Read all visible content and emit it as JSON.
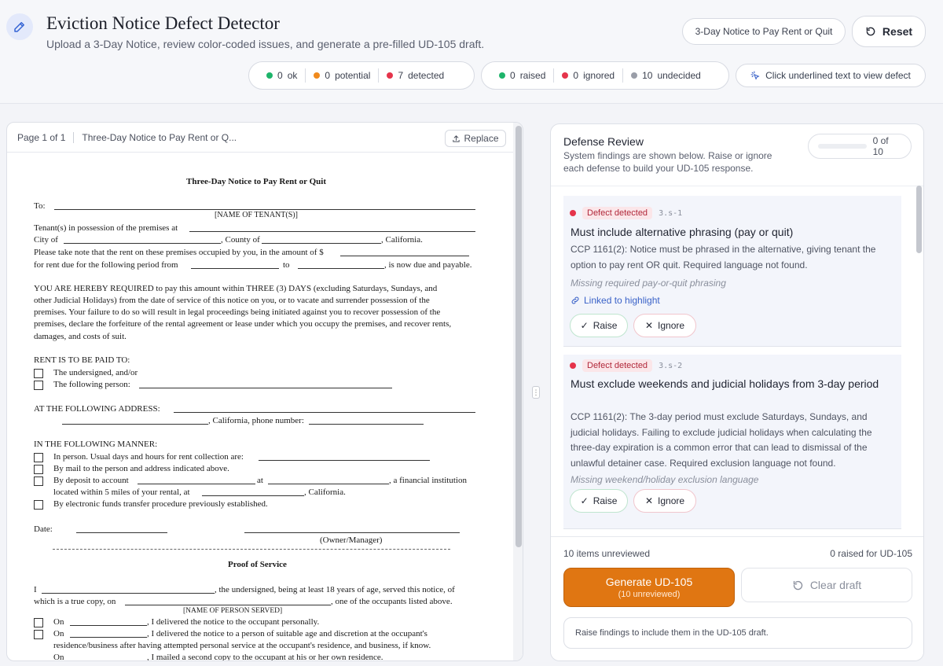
{
  "header": {
    "title": "Eviction Notice Defect Detector",
    "subtitle": "Upload a 3-Day Notice, review color-coded issues, and generate a pre-filled UD-105 draft.",
    "notice_type": "3-Day Notice to Pay Rent or Quit",
    "reset_label": "Reset",
    "hint": "Click underlined text to view defect"
  },
  "stats": {
    "severity": [
      {
        "count": "0",
        "label": "ok",
        "color": "#1db46a"
      },
      {
        "count": "0",
        "label": "potential",
        "color": "#f08a1c"
      },
      {
        "count": "7",
        "label": "detected",
        "color": "#e5344b"
      }
    ],
    "status": [
      {
        "count": "0",
        "label": "raised",
        "color": "#1db46a"
      },
      {
        "count": "0",
        "label": "ignored",
        "color": "#e5344b"
      },
      {
        "count": "10",
        "label": "undecided",
        "color": "#9a9ea8"
      }
    ]
  },
  "document": {
    "page_label": "Page 1 of 1",
    "doc_name": "Three-Day Notice to Pay Rent or Q...",
    "replace_label": "Replace",
    "lines": {
      "title": "Three-Day Notice to Pay Rent or Quit",
      "to": "To:",
      "name_of_tenant": "[NAME OF TENANT(S)]",
      "tenant_possession": "Tenant(s) in possession of the premises at",
      "city_of": "City of",
      "county_of": ", County of",
      "california": ", California.",
      "please_take": "Please take note that the rent on these premises occupied by you, in the amount of $",
      "for_rent_due": "for rent due for the following period from",
      "to_word": "to",
      "now_due": ", is now due and payable.",
      "required_1": "YOU ARE HEREBY REQUIRED to pay this amount within THREE (3) DAYS (excluding Saturdays, Sundays, and",
      "required_2": "other Judicial Holidays) from the date of service of this notice on you, or to vacate and surrender possession of the",
      "required_3": "premises. Your failure to do so will result in legal proceedings being initiated against you to recover possession of the",
      "required_4": "premises, declare the forfeiture of the rental agreement or lease under which you occupy the premises, and recover rents,",
      "required_5": "damages, and costs of suit.",
      "rent_paid_to": "RENT IS TO BE PAID TO:",
      "undersigned": "The undersigned, and/or",
      "following_person": "The following person:",
      "at_address": "AT THE FOLLOWING ADDRESS:",
      "phone": ", California, phone number:",
      "manner": "IN THE FOLLOWING MANNER:",
      "in_person": "In person. Usual days and hours for rent collection are:",
      "by_mail": "By mail to the person and address indicated above.",
      "by_deposit": "By deposit to account",
      "at_word": "at",
      "financial": ", a financial institution",
      "within_5": "located within 5 miles of your rental, at",
      "california2": ", California.",
      "eft": "By electronic funds transfer procedure previously established.",
      "date": "Date:",
      "owner_manager": "(Owner/Manager)",
      "proof": "Proof of Service",
      "i": "I",
      "undersigned_age": ", the undersigned, being at least 18 years of age, served this notice, of",
      "true_copy": "which is a true copy, on",
      "occupants": ", one of the occupants listed above.",
      "name_served": "[NAME OF PERSON SERVED]",
      "on1": "On",
      "delivered_personally": ", I delivered the notice to the occupant personally.",
      "on2": "On",
      "delivered_suitable": ", I delivered the notice to a person of suitable age and discretion at the occupant's",
      "residence": "residence/business after having attempted personal service at the occupant's residence, and business, if know.",
      "on3": "On",
      "mailed": ", I mailed a second copy to the occupant at his or her own residence."
    }
  },
  "review": {
    "title": "Defense Review",
    "description": "System findings are shown below. Raise or ignore each defense to build your UD-105 response.",
    "progress_label": "0 of 10",
    "progress_fraction": 0,
    "findings": [
      {
        "badge": "Defect detected",
        "id": "3.s-1",
        "title": "Must include alternative phrasing (pay or quit)",
        "body": "CCP 1161(2): Notice must be phrased in the alternative, giving tenant the option to pay rent OR quit. Required language not found.",
        "note": "Missing required pay-or-quit phrasing",
        "link": "Linked to highlight",
        "raise": "Raise",
        "ignore": "Ignore"
      },
      {
        "badge": "Defect detected",
        "id": "3.s-2",
        "title": "Must exclude weekends and judicial holidays from 3-day period",
        "body": "CCP 1161(2): The 3-day period must exclude Saturdays, Sundays, and judicial holidays. Failing to exclude judicial holidays when calculating the three-day expiration is a common error that can lead to dismissal of the unlawful detainer case. Required exclusion language not found.",
        "note": "Missing weekend/holiday exclusion language",
        "raise": "Raise",
        "ignore": "Ignore"
      }
    ],
    "footer": {
      "unreviewed": "10 items unreviewed",
      "raised": "0 raised for UD-105",
      "generate": "Generate UD-105",
      "generate_sub": "(10 unreviewed)",
      "clear": "Clear draft",
      "info": "Raise findings to include them in the UD-105 draft."
    }
  },
  "colors": {
    "accent": "#e07612",
    "link": "#3a62c8",
    "defect": "#e5344b"
  }
}
